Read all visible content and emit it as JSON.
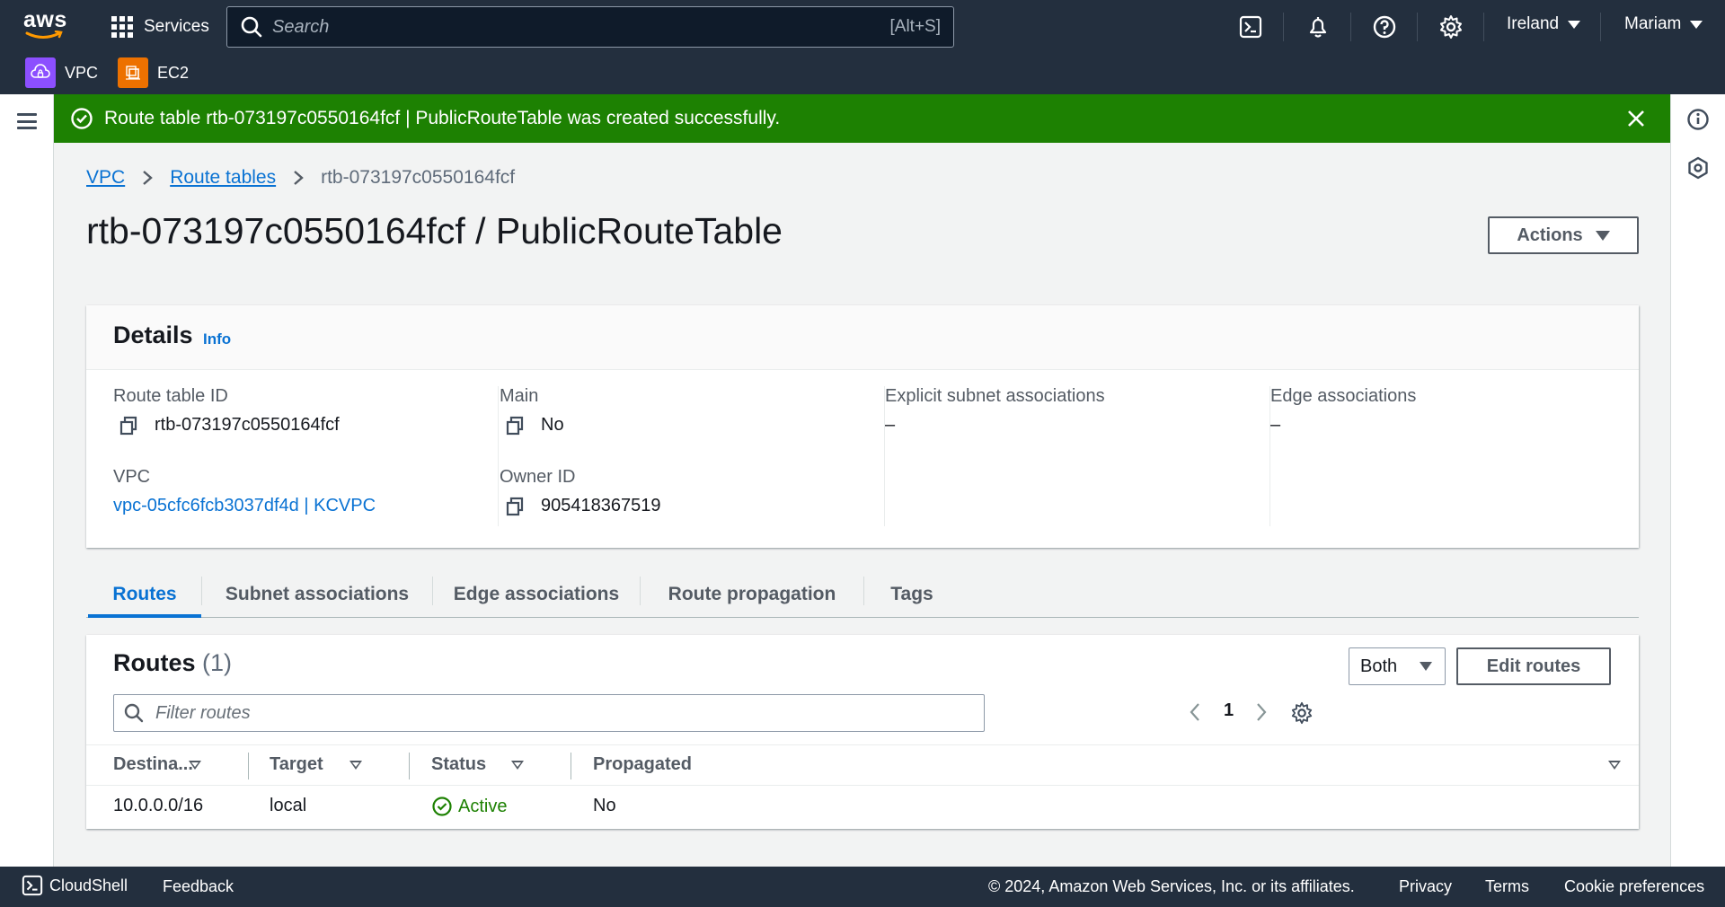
{
  "topnav": {
    "logo_text": "aws",
    "services_label": "Services",
    "search_placeholder": "Search",
    "search_hint": "[Alt+S]",
    "region_label": "Ireland",
    "user_label": "Mariam",
    "favorites": [
      {
        "label": "VPC",
        "color": "#8c4fff"
      },
      {
        "label": "EC2",
        "color": "#ed7100"
      }
    ]
  },
  "flash": {
    "message": "Route table rtb-073197c0550164fcf | PublicRouteTable was created successfully.",
    "color": "#1d8102"
  },
  "breadcrumb": {
    "items": [
      "VPC",
      "Route tables"
    ],
    "current": "rtb-073197c0550164fcf"
  },
  "page": {
    "title": "rtb-073197c0550164fcf / PublicRouteTable",
    "actions_label": "Actions"
  },
  "details": {
    "heading": "Details",
    "info_label": "Info",
    "route_table_id_label": "Route table ID",
    "route_table_id": "rtb-073197c0550164fcf",
    "main_label": "Main",
    "main_value": "No",
    "explicit_label": "Explicit subnet associations",
    "explicit_value": "–",
    "edge_label": "Edge associations",
    "edge_value": "–",
    "vpc_label": "VPC",
    "vpc_value": "vpc-05cfc6fcb3037df4d | KCVPC",
    "owner_label": "Owner ID",
    "owner_value": "905418367519"
  },
  "tabs": [
    "Routes",
    "Subnet associations",
    "Edge associations",
    "Route propagation",
    "Tags"
  ],
  "routes": {
    "heading": "Routes",
    "count": "(1)",
    "filter_select": "Both",
    "edit_label": "Edit routes",
    "filter_placeholder": "Filter routes",
    "page": "1",
    "columns": [
      "Destina...",
      "Target",
      "Status",
      "Propagated"
    ],
    "rows": [
      {
        "destination": "10.0.0.0/16",
        "target": "local",
        "status": "Active",
        "propagated": "No"
      }
    ]
  },
  "footer": {
    "cloudshell": "CloudShell",
    "feedback": "Feedback",
    "copyright": "© 2024, Amazon Web Services, Inc. or its affiliates.",
    "privacy": "Privacy",
    "terms": "Terms",
    "cookies": "Cookie preferences"
  },
  "colors": {
    "nav_bg": "#232f3e",
    "link": "#0972d3",
    "success": "#1d8102"
  }
}
